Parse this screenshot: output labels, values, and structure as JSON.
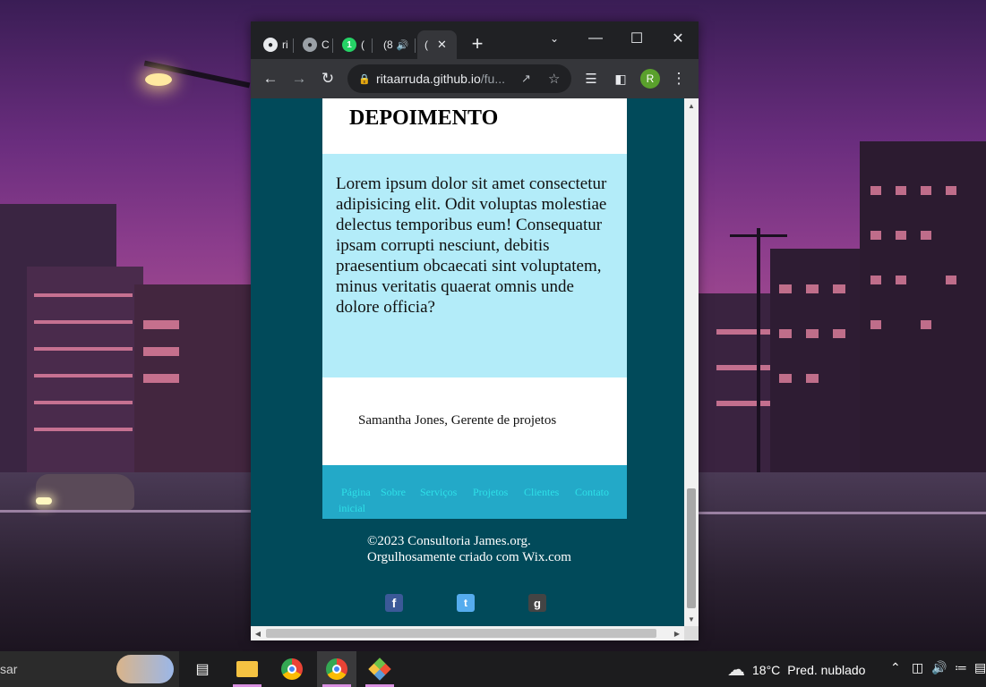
{
  "browser": {
    "tabs": [
      {
        "icon": "github-icon",
        "label": "ri"
      },
      {
        "icon": "globe-icon",
        "label": "C"
      },
      {
        "icon": "whatsapp-icon",
        "label": "("
      },
      {
        "icon": "tab-icon",
        "label": "(8"
      },
      {
        "icon": "tab-icon",
        "label": "("
      }
    ],
    "new_tab_label": "+",
    "address": {
      "host": "ritaarruda.github.io",
      "path": "/fu..."
    },
    "profile_initial": "R"
  },
  "page": {
    "section_title": "DEPOIMENTO",
    "quote": "Lorem ipsum dolor sit amet consectetur adipisicing elit. Odit voluptas molestiae delectus temporibus eum! Consequatur ipsam corrupti nesciunt, debitis praesentium obcaecati sint voluptatem, minus veritatis quaerat omnis unde dolore officia?",
    "author": "Samantha Jones, Gerente de projetos",
    "nav": [
      "Página",
      "inicial",
      "Sobre",
      "Serviços",
      "Projetos",
      "Clientes",
      "Contato"
    ],
    "footer_line1": "©2023 Consultoria James.org.",
    "footer_line2": "Orgulhosamente criado com Wix.com",
    "social": [
      {
        "icon": "facebook-icon",
        "glyph": "f",
        "color": "#3b5998"
      },
      {
        "icon": "twitter-icon",
        "glyph": "t",
        "color": "#55acee"
      },
      {
        "icon": "google-plus-icon",
        "glyph": "g",
        "color": "#444444"
      }
    ]
  },
  "taskbar": {
    "search_text": "sar",
    "weather": {
      "temperature": "18°C",
      "condition": "Pred. nublado"
    },
    "apps": [
      "task-view-icon",
      "file-explorer-icon",
      "chrome-icon",
      "chrome-profile-icon",
      "git-icon"
    ]
  },
  "colors": {
    "page_bg": "#014a5a",
    "quote_bg": "#b3ecf9",
    "nav_bg": "#23a9c8",
    "nav_link": "#2ee0e8"
  }
}
